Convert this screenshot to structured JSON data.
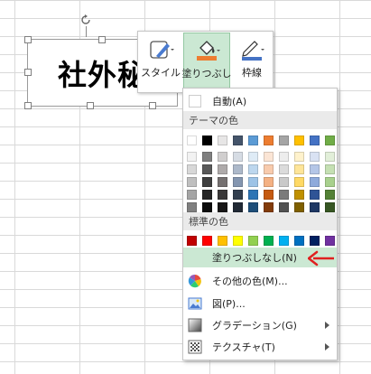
{
  "shape": {
    "text": "社外秘"
  },
  "minibar": {
    "style_label": "スタイル",
    "fill_label": "塗りつぶし",
    "outline_label": "枠線"
  },
  "menu": {
    "auto_label": "自動(A)",
    "theme_header": "テーマの色",
    "standard_header": "標準の色",
    "no_fill_label": "塗りつぶしなし(N)",
    "more_colors_label": "その他の色(M)...",
    "picture_label": "図(P)...",
    "gradient_label": "グラデーション(G)",
    "texture_label": "テクスチャ(T)"
  },
  "colors": {
    "theme_top": [
      "#ffffff",
      "#000000",
      "#e7e6e6",
      "#44546a",
      "#5b9bd5",
      "#ed7d31",
      "#a5a5a5",
      "#ffc000",
      "#4472c4",
      "#70ad47"
    ],
    "theme_shades": [
      [
        "#f2f2f2",
        "#7f7f7f",
        "#d0cece",
        "#d6dce4",
        "#deebf6",
        "#fbe5d5",
        "#ededed",
        "#fff2cc",
        "#d9e2f3",
        "#e2efd9"
      ],
      [
        "#d8d8d8",
        "#595959",
        "#aeaaaa",
        "#adb9ca",
        "#bdd7ee",
        "#f8cbad",
        "#dbdbdb",
        "#fee599",
        "#b4c6e7",
        "#c5e0b3"
      ],
      [
        "#bfbfbf",
        "#3f3f3f",
        "#757070",
        "#8496b0",
        "#9dc3e6",
        "#f4b183",
        "#c9c9c9",
        "#ffd965",
        "#8eaadb",
        "#a8d08d"
      ],
      [
        "#a5a5a5",
        "#262626",
        "#3a3838",
        "#323f4f",
        "#2e75b5",
        "#c55a11",
        "#7b7b7b",
        "#bf9000",
        "#2f5496",
        "#538135"
      ],
      [
        "#7f7f7f",
        "#0c0c0c",
        "#171616",
        "#222a35",
        "#1e4e79",
        "#833c0b",
        "#525252",
        "#7f6000",
        "#1f3864",
        "#375623"
      ]
    ],
    "standard": [
      "#c00000",
      "#ff0000",
      "#ffc000",
      "#ffff00",
      "#92d050",
      "#00b050",
      "#00b0f0",
      "#0070c0",
      "#002060",
      "#7030a0"
    ],
    "highlight": "#cbe8d3",
    "accent_red": "#e02020"
  }
}
